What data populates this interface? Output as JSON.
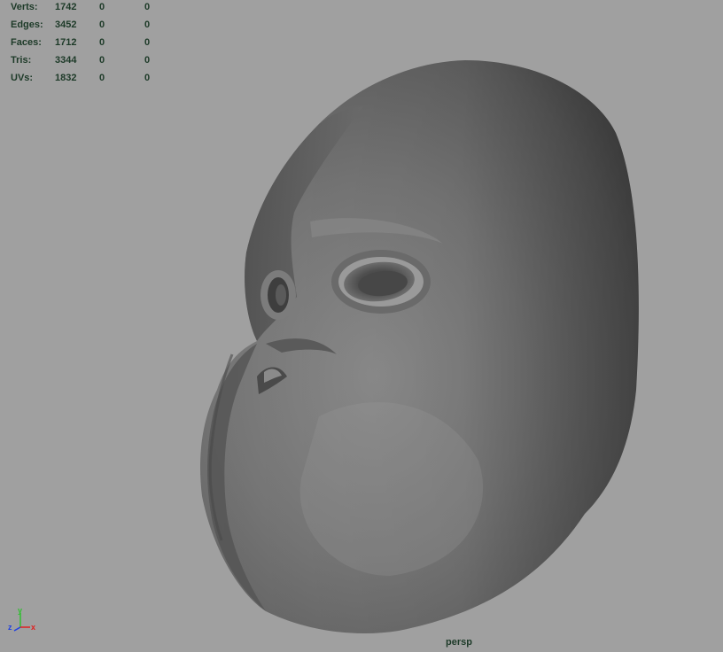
{
  "hud": {
    "rows": [
      {
        "label": "Verts:",
        "v1": "1742",
        "v2": "0",
        "v3": "0"
      },
      {
        "label": "Edges:",
        "v1": "3452",
        "v2": "0",
        "v3": "0"
      },
      {
        "label": "Faces:",
        "v1": "1712",
        "v2": "0",
        "v3": "0"
      },
      {
        "label": "Tris:",
        "v1": "3344",
        "v2": "0",
        "v3": "0"
      },
      {
        "label": "UVs:",
        "v1": "1832",
        "v2": "0",
        "v3": "0"
      }
    ]
  },
  "camera": {
    "name": "persp"
  },
  "axis": {
    "x": "x",
    "y": "y",
    "z": "z"
  },
  "colors": {
    "viewport_bg": "#a0a0a0",
    "hud_text": "#1d3a28",
    "axis_x": "#e02020",
    "axis_y": "#30c030",
    "axis_z": "#2040e0"
  }
}
